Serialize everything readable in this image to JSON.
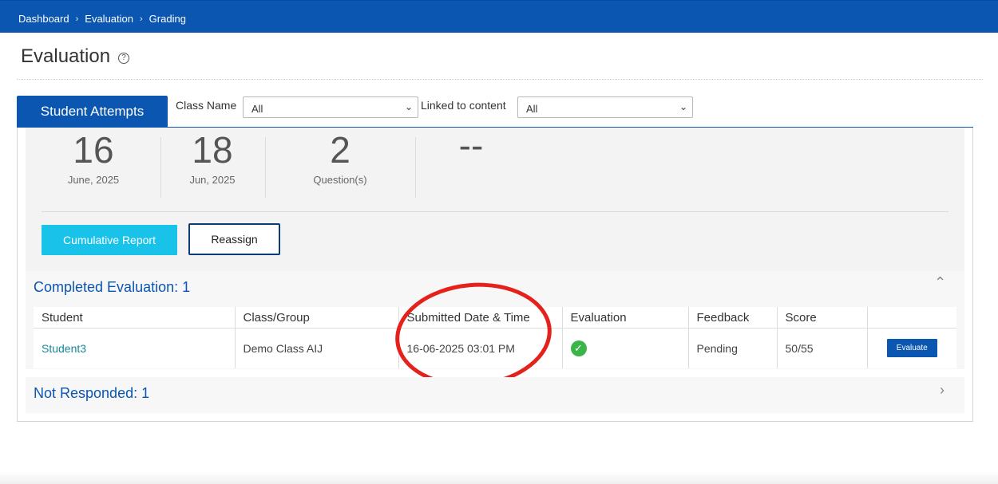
{
  "breadcrumb": [
    "Dashboard",
    "Evaluation",
    "Grading"
  ],
  "page": {
    "title": "Evaluation",
    "help_icon": "?"
  },
  "tabs": [
    {
      "label": "Student Attempts",
      "active": true
    }
  ],
  "filters": {
    "class_name": {
      "label": "Class Name",
      "value": "All"
    },
    "linked_content": {
      "label": "Linked to content",
      "value": "All"
    }
  },
  "stats": [
    {
      "big": "16",
      "small": "June, 2025"
    },
    {
      "big": "18",
      "small": "Jun, 2025"
    },
    {
      "big": "2",
      "small": "Question(s)"
    },
    {
      "big": "--",
      "small": ""
    }
  ],
  "actions": {
    "cumulative_report": "Cumulative Report",
    "reassign": "Reassign"
  },
  "completed": {
    "title": "Completed Evaluation: 1",
    "columns": [
      "Student",
      "Class/Group",
      "Submitted Date & Time",
      "Evaluation",
      "Feedback",
      "Score",
      ""
    ],
    "rows": [
      {
        "student": "Student3",
        "class_group": "Demo Class AIJ",
        "submitted": "16-06-2025 03:01 PM",
        "evaluation": "check",
        "feedback": "Pending",
        "score": "50/55",
        "action": "Evaluate"
      }
    ]
  },
  "not_responded": {
    "title": "Not Responded: 1"
  },
  "colors": {
    "brand": "#0a56b0",
    "accent": "#19c2e8",
    "annotation": "#e5211c",
    "success": "#3bb54a"
  }
}
